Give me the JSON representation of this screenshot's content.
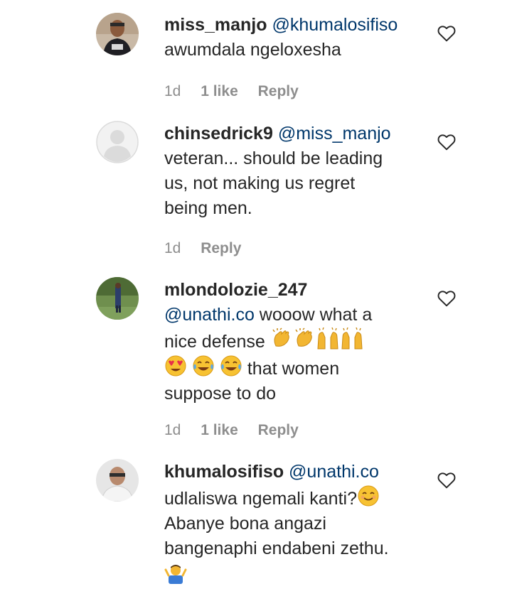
{
  "comments": [
    {
      "username": "miss_manjo",
      "mention": "@khumalosifiso",
      "lines": [
        "awumdala ngeloxesha"
      ],
      "time": "1d",
      "likes": "1 like",
      "reply": "Reply",
      "avatar": "profile-photo"
    },
    {
      "username": "chinsedrick9",
      "mention": "@miss_manjo",
      "text_line1": "veteran... should be leading",
      "text_line2": "us, not making us regret",
      "text_line3": "being men.",
      "time": "1d",
      "reply": "Reply",
      "avatar": "default-avatar"
    },
    {
      "username": "mlondolozie_247",
      "mention": "@unathi.co",
      "text_line1_rest": "wooow what a",
      "text_line2": "nice defense",
      "text_line3_rest": "that women",
      "text_line4": "suppose to do",
      "emoji_line2": [
        "clapping-hands",
        "clapping-hands",
        "raising-hands",
        "raising-hands"
      ],
      "emoji_line3": [
        "heart-eyes",
        "tears-of-joy",
        "tears-of-joy"
      ],
      "time": "1d",
      "likes": "1 like",
      "reply": "Reply",
      "avatar": "profile-photo"
    },
    {
      "username": "khumalosifiso",
      "mention": "@unathi.co",
      "text_line1": "udlaliswa ngemali kanti?",
      "text_line2": "Abanye bona angazi",
      "text_line3": "bangenaphi endabeni zethu.",
      "emoji_line1": "smiling-face",
      "emoji_line4": "shrugging-man",
      "avatar": "profile-photo"
    }
  ],
  "colors": {
    "text": "#262626",
    "mention": "#00376b",
    "meta": "#8e8e8e"
  },
  "icons": {
    "like": "heart-outline-icon"
  }
}
